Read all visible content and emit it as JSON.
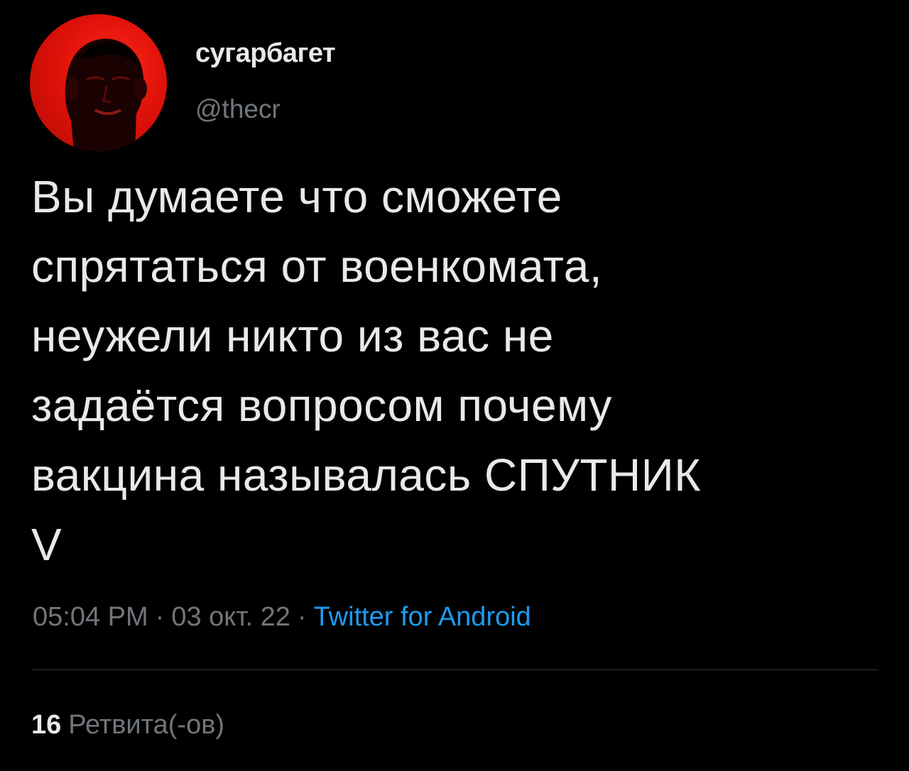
{
  "author": {
    "display_name": "сугарбагет",
    "handle": "@thecr"
  },
  "tweet": {
    "text": "Вы думаете что сможете\nспрятаться от военкомата,\nнеужели никто из вас не\nзадаётся вопросом почему\nвакцина называлась СПУТНИК\nV",
    "time": "05:04 PM",
    "date": "03 окт. 22",
    "separator": "·",
    "source": "Twitter for Android"
  },
  "stats": {
    "retweets_count": "16",
    "retweets_label": "Ретвита(-ов)"
  },
  "colors": {
    "background": "#000000",
    "text": "#e7e9ea",
    "secondary": "#71767b",
    "link": "#1d9bf0",
    "avatar_bg": "#e0120a"
  }
}
